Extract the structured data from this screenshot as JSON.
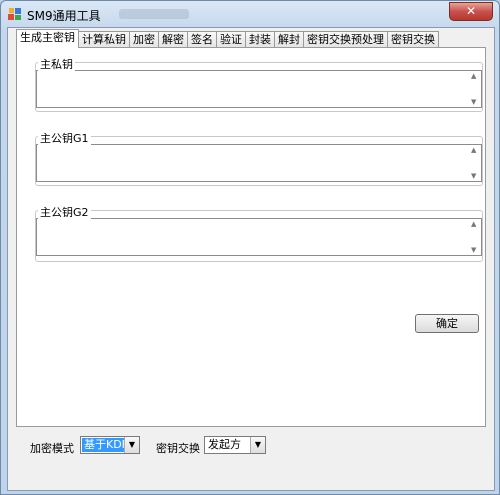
{
  "window": {
    "title": "SM9通用工具",
    "close_label": "✕"
  },
  "tabs": [
    "生成主密钥",
    "计算私钥",
    "加密",
    "解密",
    "签名",
    "验证",
    "封装",
    "解封",
    "密钥交换预处理",
    "密钥交换"
  ],
  "groups": {
    "master_private": {
      "label": "主私钥",
      "value": ""
    },
    "master_public_g1": {
      "label": "主公钥G1",
      "value": ""
    },
    "master_public_g2": {
      "label": "主公钥G2",
      "value": ""
    }
  },
  "ok_button": "确定",
  "bottom": {
    "encrypt_mode_label": "加密模式",
    "encrypt_mode_value": "基于KDF",
    "key_exchange_label": "密钥交换",
    "key_exchange_value": "发起方"
  },
  "colors": {
    "selection": "#3399ff",
    "close_button": "#c75050"
  }
}
